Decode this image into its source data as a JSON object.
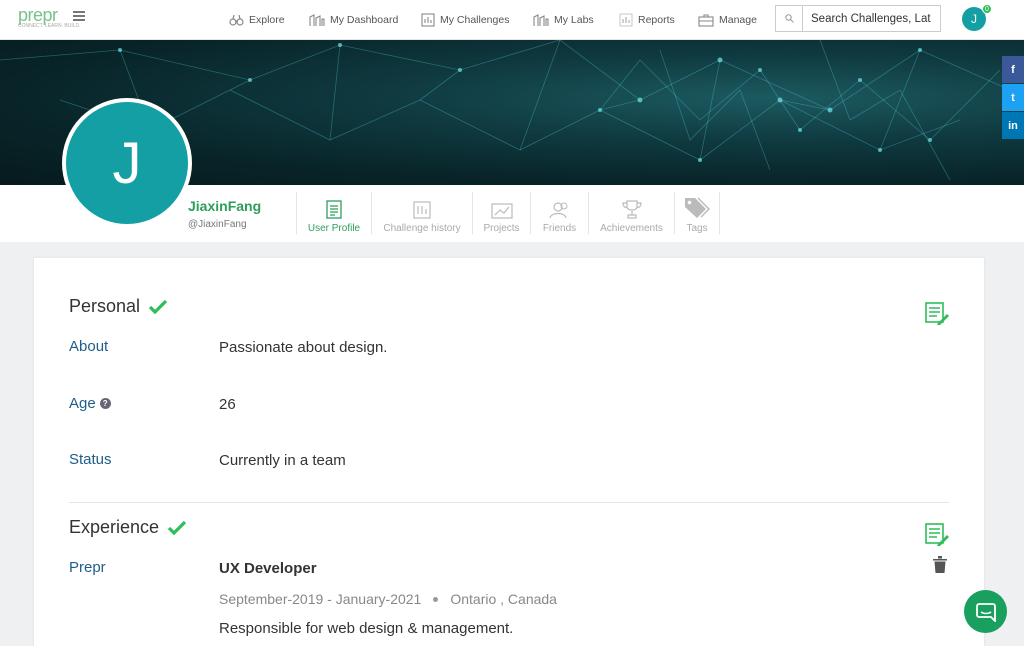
{
  "nav": {
    "logo": "prepr",
    "logo_tag": "CONNECT. LEARN. BUILD.",
    "items": [
      {
        "label": "Explore",
        "icon": "binoculars-icon"
      },
      {
        "label": "My Dashboard",
        "icon": "dashboard-icon"
      },
      {
        "label": "My Challenges",
        "icon": "challenges-icon"
      },
      {
        "label": "My Labs",
        "icon": "labs-icon"
      },
      {
        "label": "Reports",
        "icon": "reports-icon"
      },
      {
        "label": "Manage",
        "icon": "briefcase-icon"
      }
    ],
    "search_value": "Search Challenges, Lat",
    "avatar_initial": "J",
    "notification_count": "0"
  },
  "social": [
    {
      "label": "f",
      "color": "#3b5998"
    },
    {
      "label": "t",
      "color": "#1da1f2"
    },
    {
      "label": "in",
      "color": "#0077b5"
    }
  ],
  "profile": {
    "initial": "J",
    "name": "JiaxinFang",
    "handle": "@JiaxinFang",
    "tabs": [
      {
        "label": "User Profile",
        "active": true
      },
      {
        "label": "Challenge history",
        "active": false
      },
      {
        "label": "Projects",
        "active": false
      },
      {
        "label": "Friends",
        "active": false
      },
      {
        "label": "Achievements",
        "active": false
      },
      {
        "label": "Tags",
        "active": false
      }
    ]
  },
  "personal": {
    "title": "Personal",
    "fields": [
      {
        "label": "About",
        "value": "Passionate about design."
      },
      {
        "label": "Age",
        "value": "26"
      },
      {
        "label": "Status",
        "value": "Currently in a team"
      }
    ]
  },
  "experience": {
    "title": "Experience",
    "company": "Prepr",
    "role": "UX Developer",
    "dates": "September-2019 - January-2021",
    "location": "Ontario , Canada",
    "description": "Responsible for web design & management."
  },
  "colors": {
    "accent_green": "#2e9e5b",
    "teal": "#139fa4",
    "label_blue": "#1d5e8a"
  }
}
